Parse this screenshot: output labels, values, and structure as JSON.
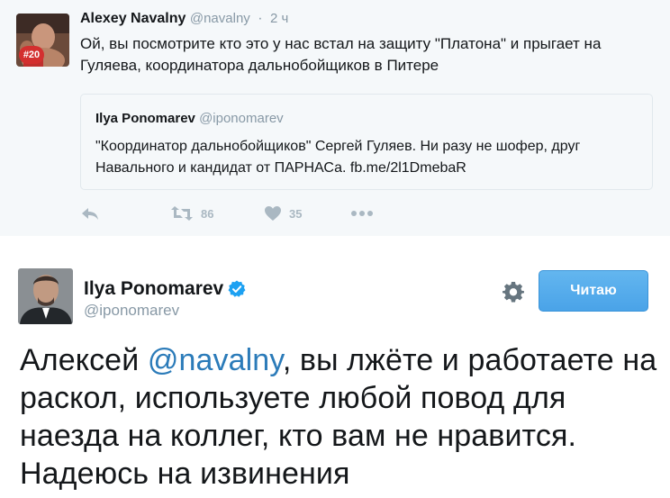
{
  "top_tweet": {
    "author_name": "Alexey Navalny",
    "author_handle": "@navalny",
    "separator": "·",
    "time": "2 ч",
    "avatar_badge": "#20",
    "text": "Ой, вы посмотрите кто это у нас встал на защиту \"Платона\" и прыгает на Гуляева, координатора дальнобойщиков в Питере",
    "quote": {
      "author_name": "Ilya Ponomarev",
      "author_handle": "@iponomarev",
      "text": "\"Координатор дальнобойщиков\" Сергей Гуляев. Ни разу не шофер, друг Навального и кандидат от ПАРНАСа. fb.me/2l1DmebaR"
    },
    "actions": {
      "reply_icon": "reply-icon",
      "retweet_icon": "retweet-icon",
      "retweet_count": "86",
      "like_icon": "heart-icon",
      "like_count": "35",
      "more_icon": "more-dots-icon"
    }
  },
  "main_tweet": {
    "author_name": "Ilya Ponomarev",
    "author_handle": "@iponomarev",
    "verified_icon": "verified-badge-icon",
    "settings_icon": "gear-icon",
    "follow_button_label": "Читаю",
    "text_before_mention": "Алексей ",
    "mention": "@navalny",
    "text_after_mention": ", вы лжёте и работаете на раскол, используете любой повод для наезда на коллег, кто вам не нравится. Надеюсь на извинения"
  },
  "colors": {
    "background_top": "#f5f8fa",
    "muted_text": "#8899a6",
    "icon_gray": "#aab8c2",
    "link_blue": "#2b7bb9",
    "button_blue": "#55acee",
    "verified_blue": "#1da1f2"
  }
}
